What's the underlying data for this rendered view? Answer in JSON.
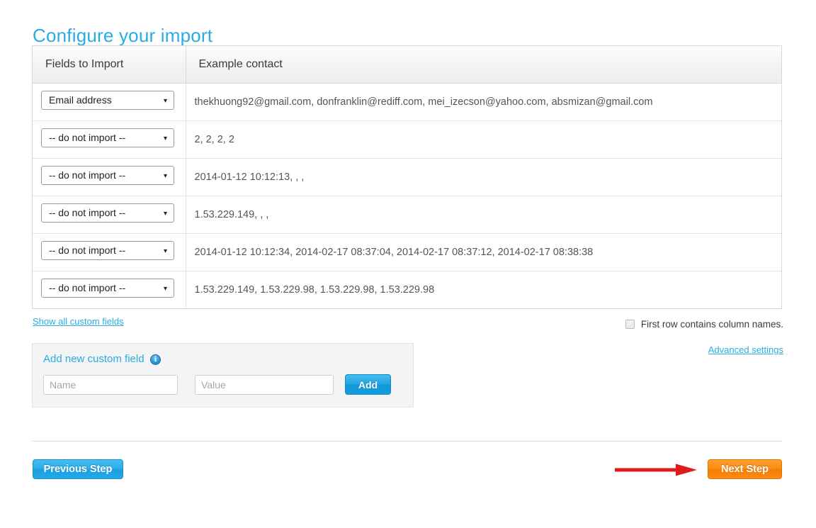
{
  "page": {
    "title": "Configure your import"
  },
  "table": {
    "headers": {
      "fields": "Fields to Import",
      "example": "Example contact"
    },
    "rows": [
      {
        "select_value": "Email address",
        "example": "thekhuong92@gmail.com, donfranklin@rediff.com, mei_izecson@yahoo.com, absmizan@gmail.com",
        "highlighted": true
      },
      {
        "select_value": "-- do not import --",
        "example": "2, 2, 2, 2",
        "highlighted": false
      },
      {
        "select_value": "-- do not import --",
        "example": "2014-01-12 10:12:13, , ,",
        "highlighted": false
      },
      {
        "select_value": "-- do not import --",
        "example": "1.53.229.149, , ,",
        "highlighted": false
      },
      {
        "select_value": "-- do not import --",
        "example": "2014-01-12 10:12:34, 2014-02-17 08:37:04, 2014-02-17 08:37:12, 2014-02-17 08:38:38",
        "highlighted": false
      },
      {
        "select_value": "-- do not import --",
        "example": "1.53.229.149, 1.53.229.98, 1.53.229.98, 1.53.229.98",
        "highlighted": false
      }
    ],
    "caret_glyph": "▾"
  },
  "controls": {
    "show_all_custom_fields": "Show all custom fields",
    "first_row_checkbox_label": "First row contains column names.",
    "first_row_checked": false,
    "advanced_settings": "Advanced settings"
  },
  "custom_field_panel": {
    "title": "Add new custom field",
    "info_glyph": "i",
    "name_placeholder": "Name",
    "name_value": "",
    "value_placeholder": "Value",
    "value_value": "",
    "add_label": "Add"
  },
  "footer": {
    "previous_label": "Previous Step",
    "next_label": "Next Step"
  },
  "colors": {
    "accent_blue": "#29ace3",
    "highlight_blue": "#8ec6f7",
    "next_orange": "#f57c00",
    "arrow_red": "#e01b1b"
  }
}
